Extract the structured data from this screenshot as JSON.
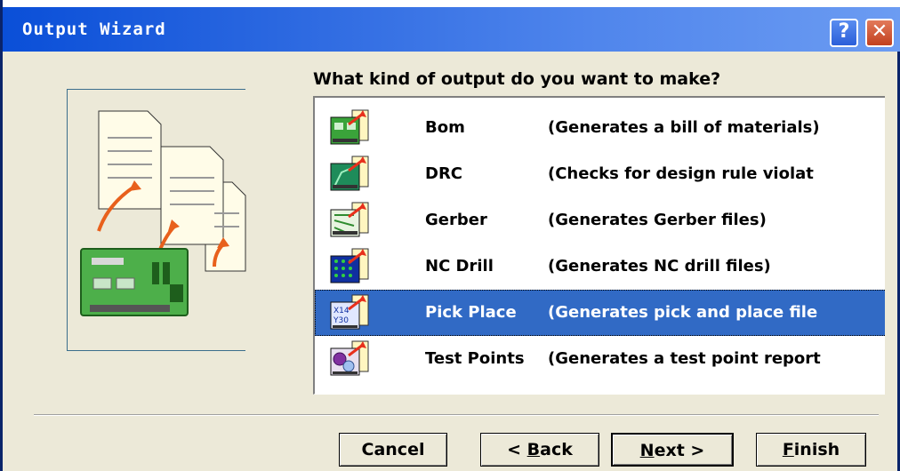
{
  "window": {
    "title": "Output Wizard",
    "help_glyph": "?",
    "close_glyph": "✕"
  },
  "prompt": "What kind of output do you want to make?",
  "outputs": [
    {
      "name": "Bom",
      "desc": "(Generates a bill of materials)",
      "icon": "bom-icon",
      "selected": false
    },
    {
      "name": "DRC",
      "desc": "(Checks for design rule violat",
      "icon": "drc-icon",
      "selected": false
    },
    {
      "name": "Gerber",
      "desc": "(Generates Gerber files)",
      "icon": "gerber-icon",
      "selected": false
    },
    {
      "name": "NC Drill",
      "desc": "(Generates NC drill files)",
      "icon": "nc-drill-icon",
      "selected": false
    },
    {
      "name": "Pick Place",
      "desc": "(Generates pick and place file",
      "icon": "pick-place-icon",
      "selected": true
    },
    {
      "name": "Test Points",
      "desc": "(Generates a test point report",
      "icon": "test-points-icon",
      "selected": false
    }
  ],
  "buttons": {
    "cancel": "Cancel",
    "back_prefix": "< ",
    "back_key": "B",
    "back_rest": "ack",
    "next_key": "N",
    "next_rest": "ext >",
    "finish_key": "F",
    "finish_rest": "inish"
  },
  "colors": {
    "selection": "#316AC5",
    "titlebar": "#0A4FD8",
    "dialog_bg": "#ECE9D8"
  }
}
